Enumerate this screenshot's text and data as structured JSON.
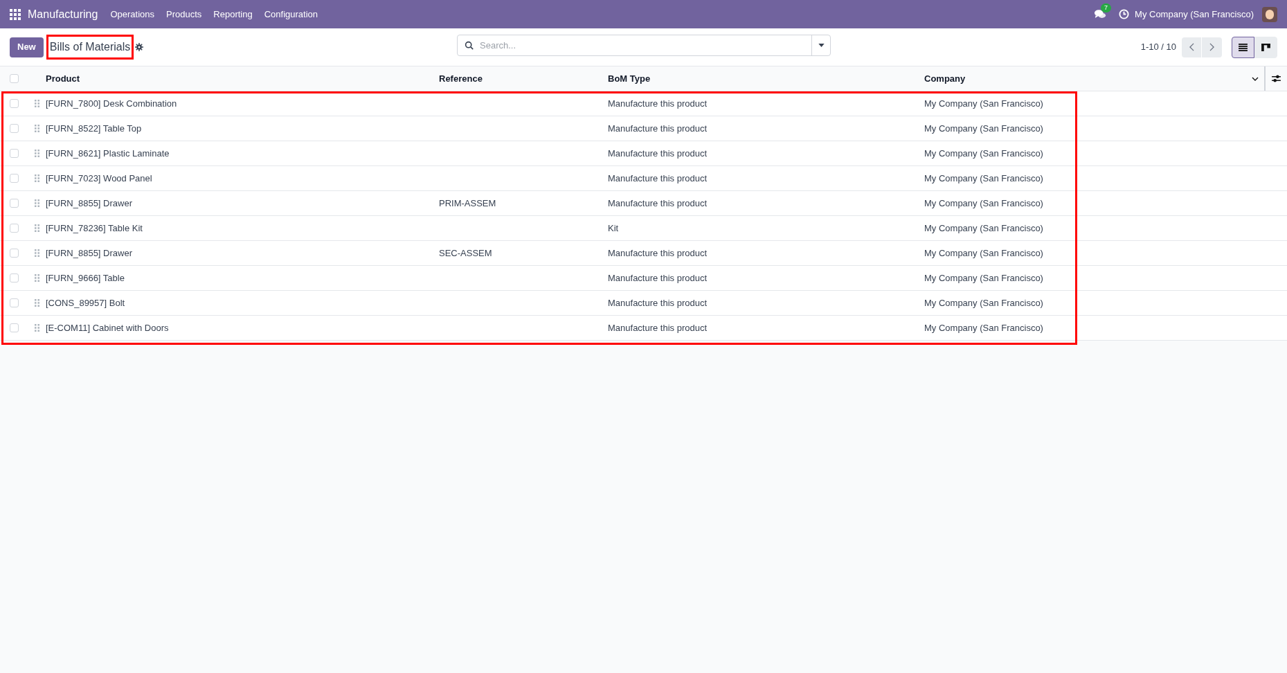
{
  "navbar": {
    "app_name": "Manufacturing",
    "menu": [
      "Operations",
      "Products",
      "Reporting",
      "Configuration"
    ],
    "messages_badge": "7",
    "company": "My Company (San Francisco)"
  },
  "control_panel": {
    "new_button": "New",
    "title": "Bills of Materials",
    "title_highlighted": true,
    "search": {
      "placeholder": "Search..."
    },
    "pager": "1-10 / 10",
    "views": [
      {
        "kind": "list",
        "selected": true
      },
      {
        "kind": "kanban",
        "selected": false
      }
    ]
  },
  "table": {
    "highlighted": true,
    "all_checked": false,
    "columns": [
      "Product",
      "Reference",
      "BoM Type",
      "Company"
    ],
    "rows": [
      {
        "checked": false,
        "product": "[FURN_7800] Desk Combination",
        "reference": "",
        "bom_type": "Manufacture this product",
        "company": "My Company (San Francisco)"
      },
      {
        "checked": false,
        "product": "[FURN_8522] Table Top",
        "reference": "",
        "bom_type": "Manufacture this product",
        "company": "My Company (San Francisco)"
      },
      {
        "checked": false,
        "product": "[FURN_8621] Plastic Laminate",
        "reference": "",
        "bom_type": "Manufacture this product",
        "company": "My Company (San Francisco)"
      },
      {
        "checked": false,
        "product": "[FURN_7023] Wood Panel",
        "reference": "",
        "bom_type": "Manufacture this product",
        "company": "My Company (San Francisco)"
      },
      {
        "checked": false,
        "product": "[FURN_8855] Drawer",
        "reference": "PRIM-ASSEM",
        "bom_type": "Manufacture this product",
        "company": "My Company (San Francisco)"
      },
      {
        "checked": false,
        "product": "[FURN_78236] Table Kit",
        "reference": "",
        "bom_type": "Kit",
        "company": "My Company (San Francisco)"
      },
      {
        "checked": false,
        "product": "[FURN_8855] Drawer",
        "reference": "SEC-ASSEM",
        "bom_type": "Manufacture this product",
        "company": "My Company (San Francisco)"
      },
      {
        "checked": false,
        "product": "[FURN_9666] Table",
        "reference": "",
        "bom_type": "Manufacture this product",
        "company": "My Company (San Francisco)"
      },
      {
        "checked": false,
        "product": "[CONS_89957] Bolt",
        "reference": "",
        "bom_type": "Manufacture this product",
        "company": "My Company (San Francisco)"
      },
      {
        "checked": false,
        "product": "[E-COM11] Cabinet with Doors",
        "reference": "",
        "bom_type": "Manufacture this product",
        "company": "My Company (San Francisco)"
      }
    ]
  }
}
